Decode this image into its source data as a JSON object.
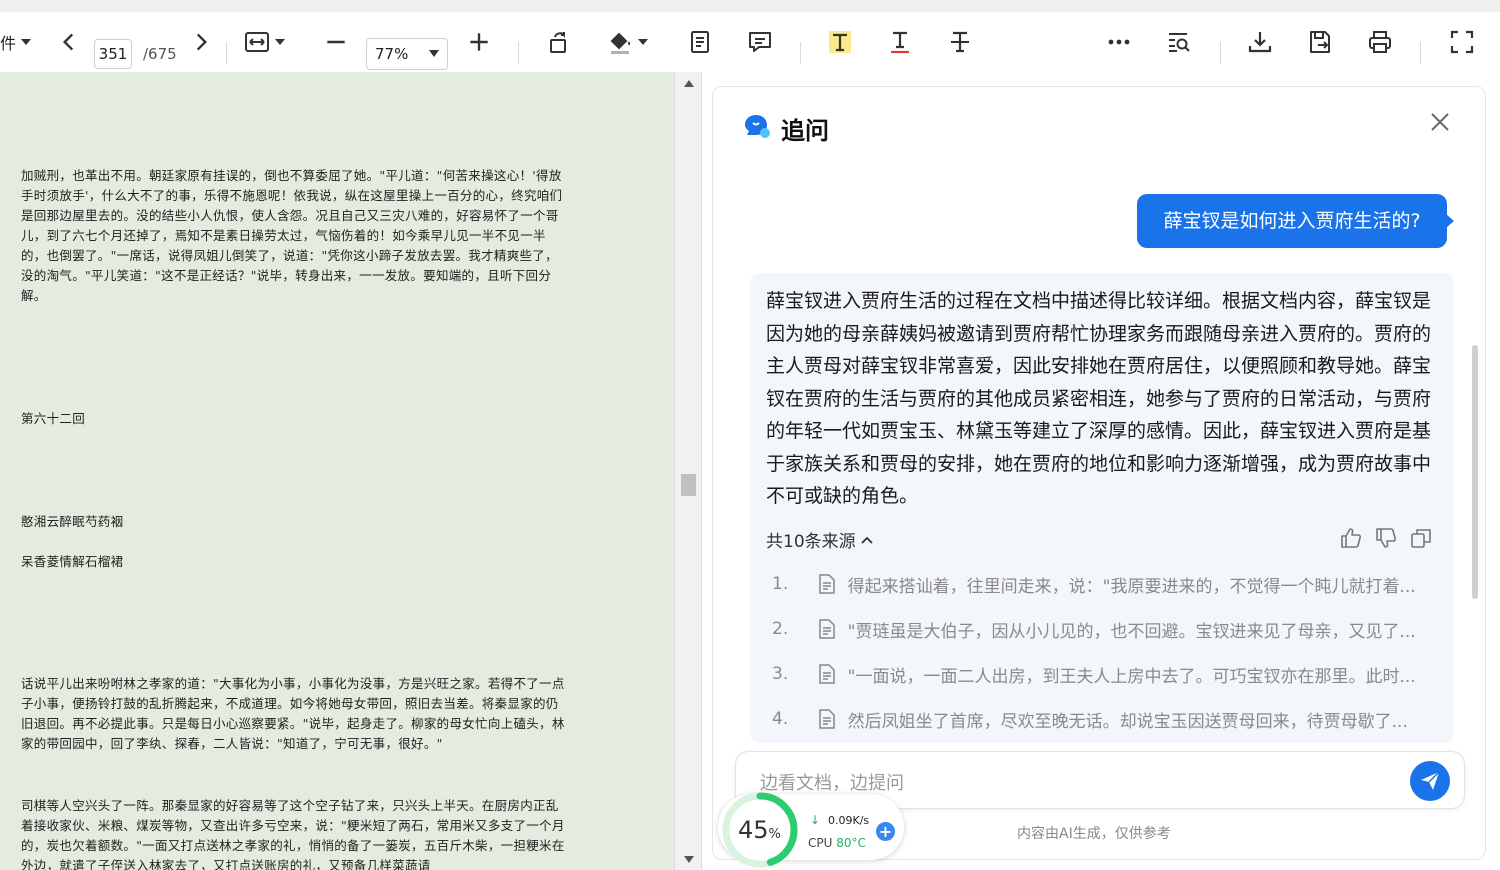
{
  "toolbar": {
    "file_menu": "件",
    "current_page": "351",
    "total_pages": "/675",
    "zoom": "77%"
  },
  "document": {
    "paragraphs": [
      "加贼刑，也革出不用。朝廷家原有挂误的，倒也不算委屈了她。\"平儿道：\"何苦来操这心！'得放手时须放手'，什么大不了的事，乐得不施恩呢！依我说，纵在这屋里操上一百分的心，终究咱们是回那边屋里去的。没的结些小人仇恨，使人含怨。况且自己又三灾八难的，好容易怀了一个哥儿，到了六七个月还掉了，焉知不是素日操劳太过，气恼伤着的！如今乘早儿见一半不见一半的，也倒罢了。\"一席话，说得凤姐儿倒笑了，说道：\"凭你这小蹄子发放去罢。我才精爽些了，没的淘气。\"平儿笑道：\"这不是正经话？\"说毕，转身出来，一一发放。要知端的，且听下回分解。",
      "第六十二回",
      "憨湘云醉眠芍药裀",
      "呆香菱情解石榴裙",
      "话说平儿出来吩咐林之孝家的道：\"大事化为小事，小事化为没事，方是兴旺之家。若得不了一点子小事，便扬铃打鼓的乱折腾起来，不成道理。如今将她母女带回，照旧去当差。将秦显家的仍旧退回。再不必提此事。只是每日小心巡察要紧。\"说毕，起身走了。柳家的母女忙向上磕头，林家的带回园中，回了李纨、探春，二人皆说：\"知道了，宁可无事，很好。\"",
      "司棋等人空兴头了一阵。那秦显家的好容易等了这个空子钻了来，只兴头上半天。在厨房内正乱着接收家伙、米粮、煤炭等物，又查出许多亏空来，说：\"粳米短了两石，常用米又多支了一个月的，炭也欠着额数。\"一面又打点送林之孝家的礼，悄悄的备了一篓炭，五百斤木柴，一担粳米在外边，就遣了子侄送入林家去了，又打点送账房的礼，又预备几样菜蔬请"
    ]
  },
  "ai_panel": {
    "title": "追问",
    "question": "薛宝钗是如何进入贾府生活的?",
    "answer": "薛宝钗进入贾府生活的过程在文档中描述得比较详细。根据文档内容，薛宝钗是因为她的母亲薛姨妈被邀请到贾府帮忙协理家务而跟随母亲进入贾府的。贾府的主人贾母对薛宝钗非常喜爱，因此安排她在贾府居住，以便照顾和教导她。薛宝钗在贾府的生活与贾府的其他成员紧密相连，她参与了贾府的日常活动，与贾府的年轻一代如贾宝玉、林黛玉等建立了深厚的感情。因此，薛宝钗进入贾府是基于家族关系和贾母的安排，她在贾府的地位和影响力逐渐增强，成为贾府故事中不可或缺的角色。",
    "sources_label": "共10条来源",
    "sources": [
      {
        "num": "1.",
        "text": "得起来搭讪着，往里间走来，说：\"我原要进来的，不觉得一个盹儿就打着..."
      },
      {
        "num": "2.",
        "text": "\"贾琏虽是大伯子，因从小儿见的，也不回避。宝钗进来见了母亲，又见了..."
      },
      {
        "num": "3.",
        "text": "\"一面说，一面二人出房，到王夫人上房中去了。可巧宝钗亦在那里。此时..."
      },
      {
        "num": "4.",
        "text": "然后凤姐坐了首席，尽欢至晚无话。却说宝玉因送贾母回来，待贾母歇了..."
      }
    ],
    "input_placeholder": "边看文档，边提问",
    "disclaimer": "内容由AI生成，仅供参考"
  },
  "monitor": {
    "percent": "45",
    "percent_unit": "%",
    "net_speed": "0.09K/s",
    "cpu_label": "CPU",
    "cpu_temp": "80°C",
    "plus": "+"
  }
}
